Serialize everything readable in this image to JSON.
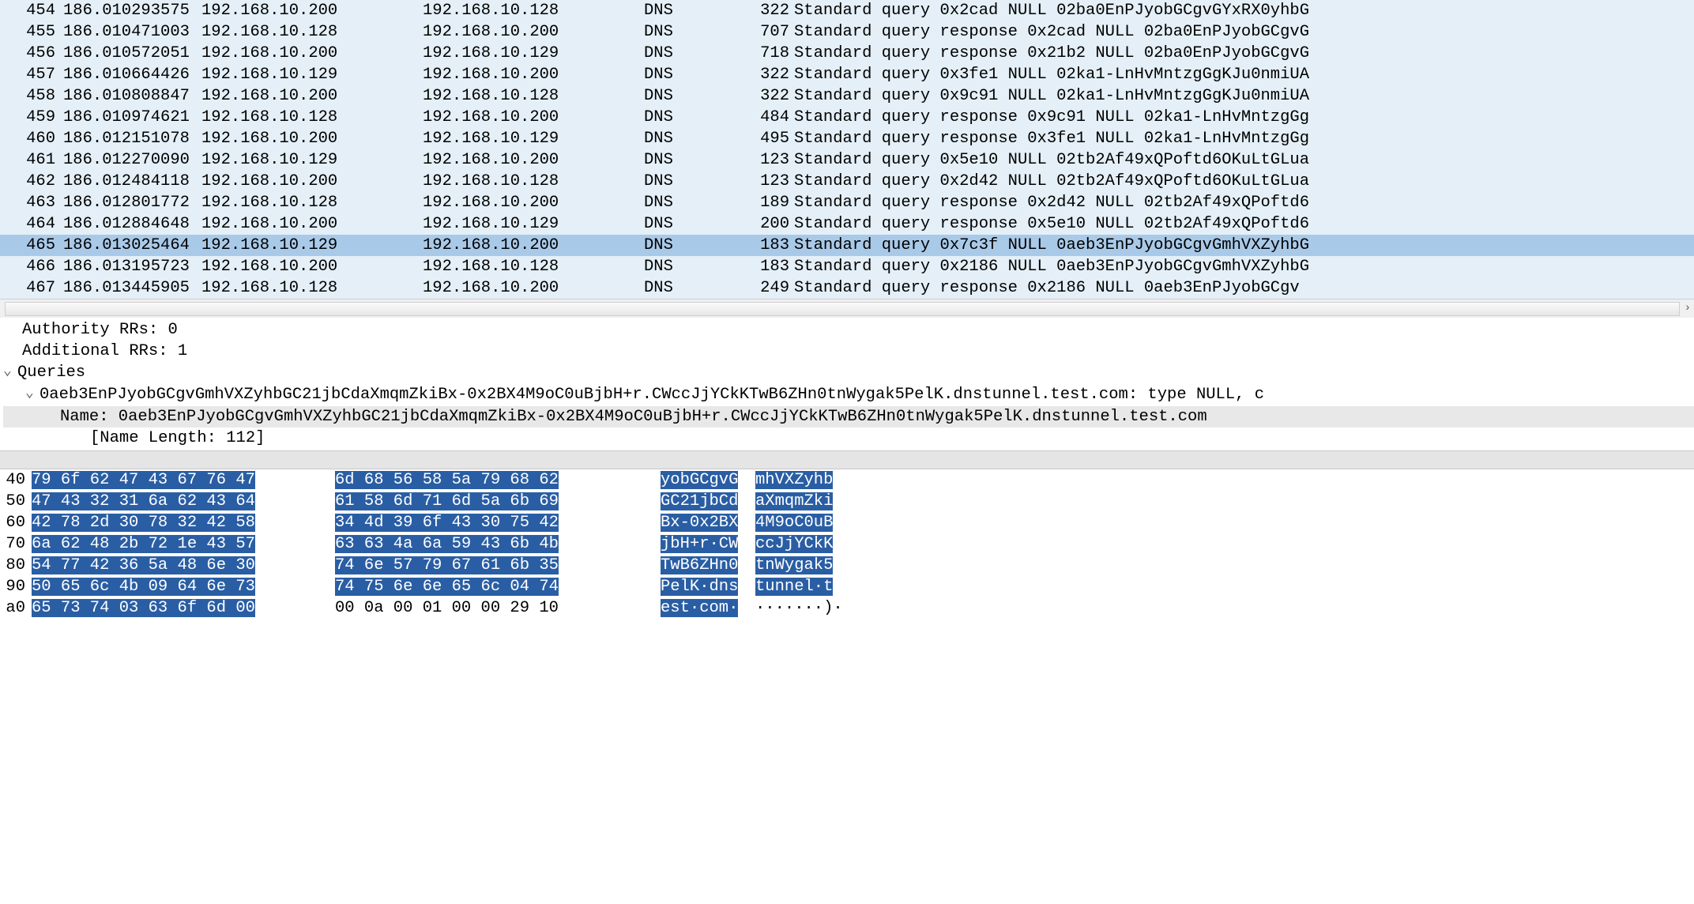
{
  "packets": [
    {
      "no": "454",
      "time": "186.010293575",
      "src": "192.168.10.200",
      "dst": "192.168.10.128",
      "prot": "DNS",
      "len": "322",
      "info": "Standard query 0x2cad NULL 02ba0EnPJyobGCgvGYxRX0yhbG"
    },
    {
      "no": "455",
      "time": "186.010471003",
      "src": "192.168.10.128",
      "dst": "192.168.10.200",
      "prot": "DNS",
      "len": "707",
      "info": "Standard query response 0x2cad NULL 02ba0EnPJyobGCgvG"
    },
    {
      "no": "456",
      "time": "186.010572051",
      "src": "192.168.10.200",
      "dst": "192.168.10.129",
      "prot": "DNS",
      "len": "718",
      "info": "Standard query response 0x21b2 NULL 02ba0EnPJyobGCgvG"
    },
    {
      "no": "457",
      "time": "186.010664426",
      "src": "192.168.10.129",
      "dst": "192.168.10.200",
      "prot": "DNS",
      "len": "322",
      "info": "Standard query 0x3fe1 NULL 02ka1-LnHvMntzgGgKJu0nmiUA"
    },
    {
      "no": "458",
      "time": "186.010808847",
      "src": "192.168.10.200",
      "dst": "192.168.10.128",
      "prot": "DNS",
      "len": "322",
      "info": "Standard query 0x9c91 NULL 02ka1-LnHvMntzgGgKJu0nmiUA"
    },
    {
      "no": "459",
      "time": "186.010974621",
      "src": "192.168.10.128",
      "dst": "192.168.10.200",
      "prot": "DNS",
      "len": "484",
      "info": "Standard query response 0x9c91 NULL 02ka1-LnHvMntzgGg"
    },
    {
      "no": "460",
      "time": "186.012151078",
      "src": "192.168.10.200",
      "dst": "192.168.10.129",
      "prot": "DNS",
      "len": "495",
      "info": "Standard query response 0x3fe1 NULL 02ka1-LnHvMntzgGg"
    },
    {
      "no": "461",
      "time": "186.012270090",
      "src": "192.168.10.129",
      "dst": "192.168.10.200",
      "prot": "DNS",
      "len": "123",
      "info": "Standard query 0x5e10 NULL 02tb2Af49xQPoftd6OKuLtGLua"
    },
    {
      "no": "462",
      "time": "186.012484118",
      "src": "192.168.10.200",
      "dst": "192.168.10.128",
      "prot": "DNS",
      "len": "123",
      "info": "Standard query 0x2d42 NULL 02tb2Af49xQPoftd6OKuLtGLua"
    },
    {
      "no": "463",
      "time": "186.012801772",
      "src": "192.168.10.128",
      "dst": "192.168.10.200",
      "prot": "DNS",
      "len": "189",
      "info": "Standard query response 0x2d42 NULL 02tb2Af49xQPoftd6"
    },
    {
      "no": "464",
      "time": "186.012884648",
      "src": "192.168.10.200",
      "dst": "192.168.10.129",
      "prot": "DNS",
      "len": "200",
      "info": "Standard query response 0x5e10 NULL 02tb2Af49xQPoftd6"
    },
    {
      "no": "465",
      "time": "186.013025464",
      "src": "192.168.10.129",
      "dst": "192.168.10.200",
      "prot": "DNS",
      "len": "183",
      "info": "Standard query 0x7c3f NULL 0aeb3EnPJyobGCgvGmhVXZyhbG",
      "sel": true
    },
    {
      "no": "466",
      "time": "186.013195723",
      "src": "192.168.10.200",
      "dst": "192.168.10.128",
      "prot": "DNS",
      "len": "183",
      "info": "Standard query 0x2186 NULL 0aeb3EnPJyobGCgvGmhVXZyhbG"
    },
    {
      "no": "467",
      "time": "186.013445905",
      "src": "192.168.10.128",
      "dst": "192.168.10.200",
      "prot": "DNS",
      "len": "249",
      "info": "Standard query response 0x2186 NULL 0aeb3EnPJyobGCgv"
    }
  ],
  "scroll_arrow": "›",
  "details": {
    "auth": "Authority RRs: 0",
    "add": "Additional RRs: 1",
    "queries": "Queries",
    "qline": "0aeb3EnPJyobGCgvGmhVXZyhbGC21jbCdaXmqmZkiBx-0x2BX4M9oC0uBjbH+r.CWccJjYCkKTwB6ZHn0tnWygak5PelK.dnstunnel.test.com: type NULL, c",
    "name": "Name: 0aeb3EnPJyobGCgvGmhVXZyhbGC21jbCdaXmqmZkiBx-0x2BX4M9oC0uBjbH+r.CWccJjYCkKTwB6ZHn0tnWygak5PelK.dnstunnel.test.com",
    "len": "[Name Length: 112]"
  },
  "hex": [
    {
      "off": "40",
      "b1": "79 6f 62 47 43 67 76 47",
      "b2": "6d 68 56 58 5a 79 68 62",
      "a1": "yobGCgvG",
      "a2": "mhVXZyhb",
      "h1": 8,
      "h2": 8,
      "ha1": 8,
      "ha2": 8
    },
    {
      "off": "50",
      "b1": "47 43 32 31 6a 62 43 64",
      "b2": "61 58 6d 71 6d 5a 6b 69",
      "a1": "GC21jbCd",
      "a2": "aXmqmZki",
      "h1": 8,
      "h2": 8,
      "ha1": 8,
      "ha2": 8
    },
    {
      "off": "60",
      "b1": "42 78 2d 30 78 32 42 58",
      "b2": "34 4d 39 6f 43 30 75 42",
      "a1": "Bx-0x2BX",
      "a2": "4M9oC0uB",
      "h1": 8,
      "h2": 8,
      "ha1": 8,
      "ha2": 8
    },
    {
      "off": "70",
      "b1": "6a 62 48 2b 72 1e 43 57",
      "b2": "63 63 4a 6a 59 43 6b 4b",
      "a1": "jbH+r·CW",
      "a2": "ccJjYCkK",
      "h1": 8,
      "h2": 8,
      "ha1": 8,
      "ha2": 8
    },
    {
      "off": "80",
      "b1": "54 77 42 36 5a 48 6e 30",
      "b2": "74 6e 57 79 67 61 6b 35",
      "a1": "TwB6ZHn0",
      "a2": "tnWygak5",
      "h1": 8,
      "h2": 8,
      "ha1": 8,
      "ha2": 8
    },
    {
      "off": "90",
      "b1": "50 65 6c 4b 09 64 6e 73",
      "b2": "74 75 6e 6e 65 6c 04 74",
      "a1": "PelK·dns",
      "a2": "tunnel·t",
      "h1": 8,
      "h2": 8,
      "ha1": 8,
      "ha2": 8
    },
    {
      "off": "a0",
      "b1": "65 73 74 03 63 6f 6d 00",
      "b2": "00 0a 00 01 00 00 29 10",
      "a1": "est·com·",
      "a2": "·······)·",
      "h1": 8,
      "h2": 0,
      "ha1": 8,
      "ha2": 0
    }
  ]
}
